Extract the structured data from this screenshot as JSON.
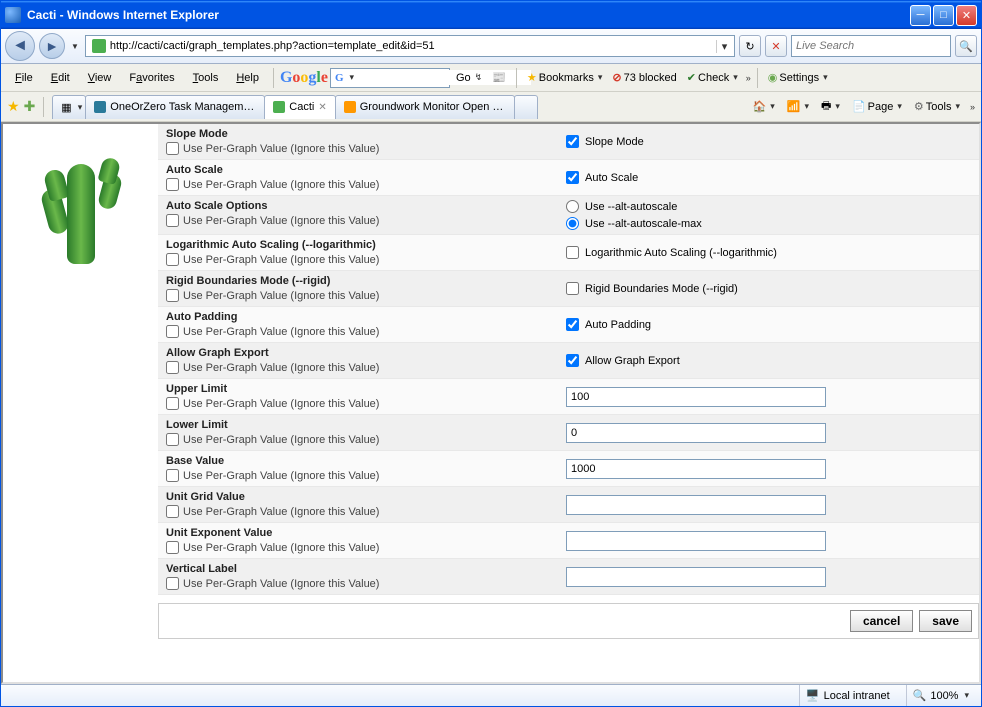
{
  "window": {
    "title": "Cacti - Windows Internet Explorer"
  },
  "address": {
    "url": "http://cacti/cacti/graph_templates.php?action=template_edit&id=51"
  },
  "search": {
    "placeholder": "Live Search"
  },
  "menubar": {
    "file": "File",
    "edit": "Edit",
    "view": "View",
    "favorites": "Favorites",
    "tools": "Tools",
    "help": "Help"
  },
  "google_toolbar": {
    "go": "Go",
    "bookmarks": "Bookmarks",
    "blocked_count": "73 blocked",
    "check": "Check",
    "settings": "Settings"
  },
  "tabs": {
    "t1": "OneOrZero Task Managemen...",
    "t2": "Cacti",
    "t3": "Groundwork Monitor Open S..."
  },
  "cmdbar": {
    "page": "Page",
    "tools": "Tools"
  },
  "form": {
    "per_graph_label": "Use Per-Graph Value (Ignore this Value)",
    "rows": {
      "slope_mode": {
        "label": "Slope Mode",
        "right_label": "Slope Mode",
        "checked": true
      },
      "auto_scale": {
        "label": "Auto Scale",
        "right_label": "Auto Scale",
        "checked": true
      },
      "auto_scale_options": {
        "label": "Auto Scale Options",
        "opt1": "Use --alt-autoscale",
        "opt2": "Use --alt-autoscale-max"
      },
      "logarithmic": {
        "label": "Logarithmic Auto Scaling (--logarithmic)",
        "right_label": "Logarithmic Auto Scaling (--logarithmic)",
        "checked": false
      },
      "rigid": {
        "label": "Rigid Boundaries Mode (--rigid)",
        "right_label": "Rigid Boundaries Mode (--rigid)",
        "checked": false
      },
      "auto_padding": {
        "label": "Auto Padding",
        "right_label": "Auto Padding",
        "checked": true
      },
      "allow_export": {
        "label": "Allow Graph Export",
        "right_label": "Allow Graph Export",
        "checked": true
      },
      "upper_limit": {
        "label": "Upper Limit",
        "value": "100"
      },
      "lower_limit": {
        "label": "Lower Limit",
        "value": "0"
      },
      "base_value": {
        "label": "Base Value",
        "value": "1000"
      },
      "unit_grid": {
        "label": "Unit Grid Value",
        "value": ""
      },
      "unit_exp": {
        "label": "Unit Exponent Value",
        "value": ""
      },
      "vertical_label": {
        "label": "Vertical Label",
        "value": ""
      }
    }
  },
  "actions": {
    "cancel": "cancel",
    "save": "save"
  },
  "statusbar": {
    "zone": "Local intranet",
    "zoom": "100%"
  }
}
